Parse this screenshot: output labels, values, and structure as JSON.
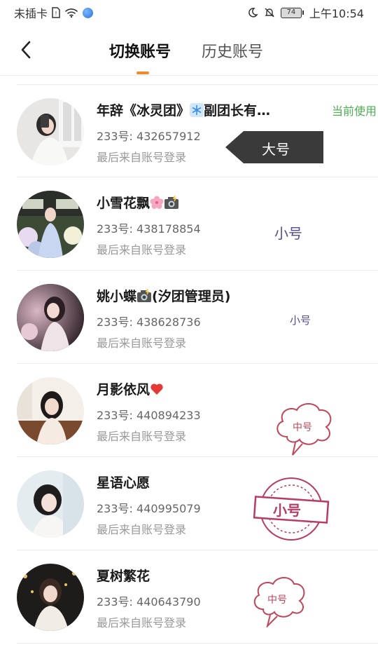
{
  "status_bar": {
    "carrier": "未插卡",
    "battery": "74",
    "time": "上午10:54"
  },
  "header": {
    "tabs": [
      {
        "label": "切换账号",
        "active": true
      },
      {
        "label": "历史账号",
        "active": false
      }
    ],
    "accent_color": "#f08a2c"
  },
  "accounts": [
    {
      "name": "年辞《冰灵团》",
      "name_suffix": "副团长有…",
      "uid": "233号: 432657912",
      "last_login": "最后来自账号登录",
      "status": "当前使用",
      "tag": "大号"
    },
    {
      "name": "小雪花飘",
      "uid": "233号: 438178854",
      "last_login": "最后来自账号登录",
      "tag": "小号"
    },
    {
      "name": "姚小蝶",
      "name_suffix": "(汐团管理员)",
      "uid": "233号: 438628736",
      "last_login": "最后来自账号登录",
      "tag": "小号"
    },
    {
      "name": "月影依风",
      "uid": "233号: 440894233",
      "last_login": "最后来自账号登录",
      "tag": "中号"
    },
    {
      "name": "星语心愿",
      "uid": "233号: 440995079",
      "last_login": "最后来自账号登录",
      "tag": "小号"
    },
    {
      "name": "夏树繁花",
      "uid": "233号: 440643790",
      "last_login": "最后来自账号登录",
      "tag": "中号"
    }
  ],
  "colors": {
    "current_status": "#4caf50",
    "big_tag_bg": "#3a3a3a",
    "small_tag_text": "#554a9a",
    "cloud_tag": "#c0465a",
    "stamp": "#b83b66"
  }
}
